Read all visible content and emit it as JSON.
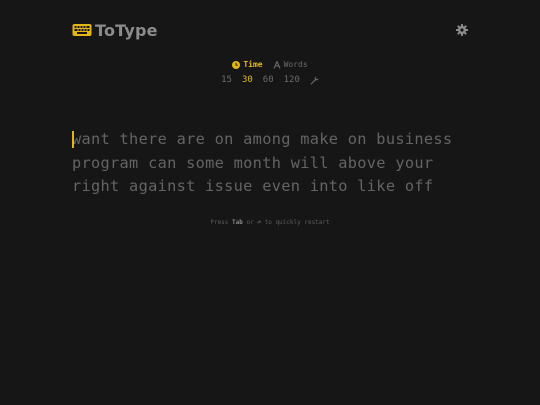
{
  "app": {
    "name": "ToType",
    "logo_icon": "keyboard-icon",
    "settings_icon": "gear-icon"
  },
  "modes": [
    {
      "label": "Time",
      "icon": "clock-icon",
      "active": true
    },
    {
      "label": "Words",
      "icon": "font-letter-icon",
      "active": false
    }
  ],
  "durations": [
    {
      "label": "15",
      "active": false
    },
    {
      "label": "30",
      "active": true
    },
    {
      "label": "60",
      "active": false
    },
    {
      "label": "120",
      "active": false
    }
  ],
  "custom_icon": "wrench-icon",
  "words": {
    "lines": [
      "want there are on among make on business",
      "program can some month will above your",
      "right against issue even into like off"
    ]
  },
  "hint": {
    "prefix": "Press",
    "key1": "Tab",
    "or": "or",
    "key2": "⏎",
    "suffix": "to quickly restart"
  },
  "colors": {
    "background": "#161616",
    "accent": "#e2b714",
    "text_untyped": "#646464",
    "muted": "#6b6b6b"
  }
}
